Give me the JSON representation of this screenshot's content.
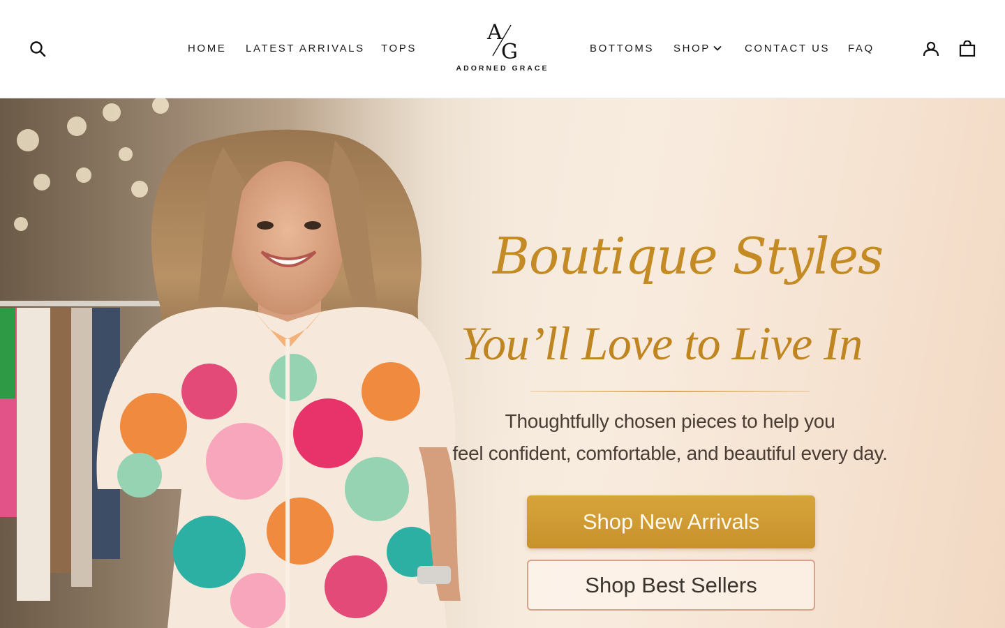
{
  "header": {
    "nav_left": [
      {
        "label": "HOME"
      },
      {
        "label": "LATEST ARRIVALS"
      },
      {
        "label": "TOPS"
      }
    ],
    "nav_right": [
      {
        "label": "BOTTOMS"
      },
      {
        "label": "SHOP"
      },
      {
        "label": "CONTACT US"
      },
      {
        "label": "FAQ"
      }
    ],
    "logo": {
      "monogram_top": "A",
      "monogram_bottom": "G",
      "brand_name": "ADORNED GRACE"
    },
    "icons": {
      "search": "search-icon",
      "account": "account-icon",
      "cart": "cart-icon",
      "shop_dropdown": "chevron-down-icon"
    }
  },
  "hero": {
    "headline_script": "Boutique Styles",
    "headline_serif": "You’ll Love to Live In",
    "subtext_line1": "Thoughtfully chosen pieces to help you",
    "subtext_line2": "feel confident, comfortable, and beautiful every day.",
    "primary_cta": "Shop New Arrivals",
    "secondary_cta": "Shop Best Sellers",
    "colors": {
      "accent_gold": "#c8922b",
      "secondary_border": "#d9a08a",
      "text_brown": "#4a3d34"
    }
  }
}
